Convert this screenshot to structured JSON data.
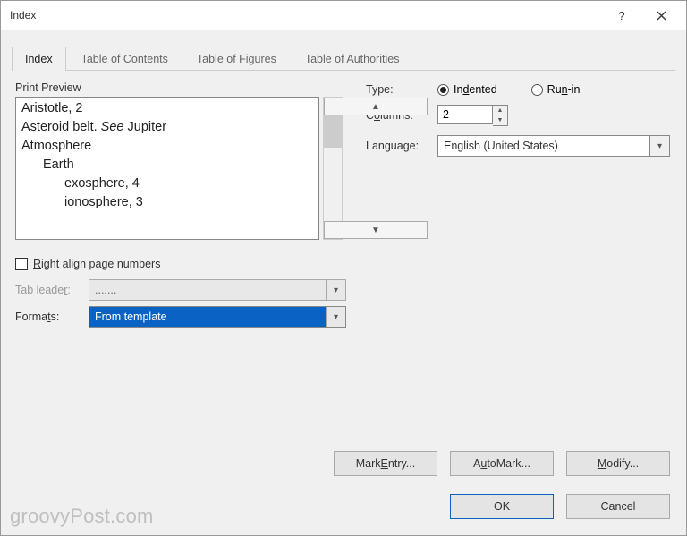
{
  "titlebar": {
    "title": "Index"
  },
  "tabs": [
    "Index",
    "Table of Contents",
    "Table of Figures",
    "Table of Authorities"
  ],
  "activeTab": 0,
  "preview": {
    "label": "Print Preview",
    "lines": [
      {
        "text": "Aristotle, 2",
        "indent": 0
      },
      {
        "text_pre": "Asteroid belt. ",
        "text_see": "See",
        "text_post": " Jupiter",
        "indent": 0,
        "see": true
      },
      {
        "text": "Atmosphere",
        "indent": 0
      },
      {
        "text": "Earth",
        "indent": 1
      },
      {
        "text": "exosphere, 4",
        "indent": 2
      },
      {
        "text": "ionosphere, 3",
        "indent": 2
      }
    ]
  },
  "left": {
    "rightAlign": {
      "checked": false,
      "label": "Right align page numbers"
    },
    "tabLeader": {
      "label": "Tab leader:",
      "value": "......."
    },
    "formats": {
      "label": "Formats:",
      "value": "From template"
    }
  },
  "right": {
    "type": {
      "label": "Type:",
      "options": [
        "Indented",
        "Run-in"
      ],
      "selected": 0
    },
    "columns": {
      "label": "Columns:",
      "value": "2"
    },
    "language": {
      "label": "Language:",
      "value": "English (United States)"
    }
  },
  "buttons": {
    "markEntry": "Mark Entry...",
    "autoMark": "AutoMark...",
    "modify": "Modify...",
    "ok": "OK",
    "cancel": "Cancel"
  },
  "watermark": "groovyPost.com"
}
